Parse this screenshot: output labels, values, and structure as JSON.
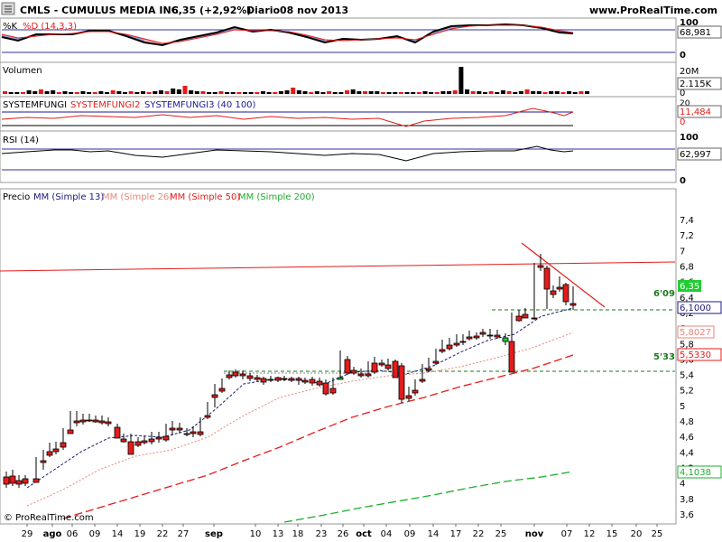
{
  "header": {
    "title": "CMLS - CUMULUS MEDIA INC.",
    "price": "6,35 (+2,92%)",
    "period": "Diario",
    "date": "08 nov 2013",
    "site": "www.ProRealTime.com",
    "copyright": "© ProRealTime.com"
  },
  "panels": {
    "stoch": {
      "label_k": "%K",
      "label_d": "%D (14,3,3)",
      "axis_ticks": [
        "100",
        "0"
      ],
      "value": "68,981"
    },
    "volume": {
      "label": "Volumen",
      "axis_ticks": [
        "20M",
        "0"
      ],
      "value": "2.115K"
    },
    "sysfungi": {
      "label_1": "SYSTEMFUNGI",
      "label_2": "SYSTEMFUNGI2",
      "label_3": "SYSTEMFUNGI3 (40 100)",
      "axis_ticks": [
        "20",
        "0"
      ],
      "value": "11,484",
      "value2": "0"
    },
    "rsi": {
      "label": "RSI (14)",
      "axis_ticks": [
        "100",
        "0"
      ],
      "value": "62,997"
    },
    "price": {
      "label_precio": "Precio",
      "label_mm13": "MM (Simple 13)",
      "label_mm26": "MM (Simple 26)",
      "label_mm50": "MM (Simple 50)",
      "label_mm200": "MM (Simple 200)",
      "axis_ticks": [
        "7,4",
        "7,2",
        "7",
        "6,8",
        "6,6",
        "6,4",
        "6,2",
        "6",
        "5,8",
        "5,6",
        "5,4",
        "5,2",
        "5",
        "4,8",
        "4,6",
        "4,4",
        "4,2",
        "4",
        "3,8",
        "3,6"
      ],
      "last_price": "6,35",
      "mm13_value": "6,1000",
      "mm26_value": "5,8027",
      "mm50_value": "5,5330",
      "mm200_value": "4,1038",
      "support_label_high": "6'09",
      "support_label_low": "5'33"
    }
  },
  "x_axis": {
    "labels": [
      "29",
      "ago",
      "06",
      "09",
      "14",
      "19",
      "22",
      "27",
      "sep",
      "10",
      "13",
      "18",
      "23",
      "26",
      "oct",
      "04",
      "09",
      "14",
      "17",
      "22",
      "25",
      "nov",
      "07",
      "12",
      "15",
      "20",
      "25"
    ]
  },
  "colors": {
    "up": "#22cc33",
    "down": "#e31b1b",
    "mm13": "#1a1a7a",
    "mm26": "#e8857a",
    "mm50": "#e31b1b",
    "mm200": "#1fae2e",
    "trendline": "#e31b1b",
    "support": "#1b7a1b",
    "stoch_fill_up": "#8a9ae0",
    "stoch_fill_down": "#f0a8a8"
  }
}
